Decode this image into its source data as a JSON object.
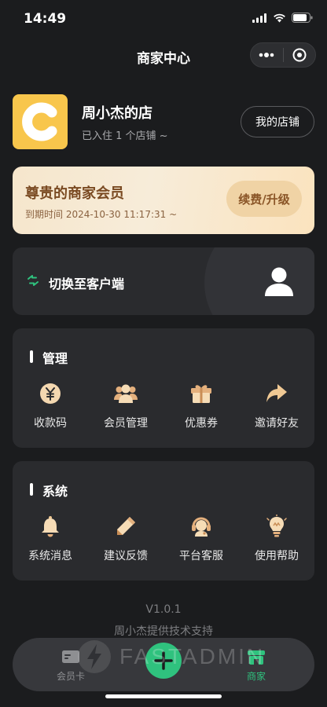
{
  "status": {
    "time": "14:49"
  },
  "nav": {
    "title": "商家中心"
  },
  "shop": {
    "name": "周小杰的店",
    "subtitle": "已入住 1 个店铺 ~",
    "my_shop_label": "我的店铺"
  },
  "vip": {
    "title": "尊贵的商家会员",
    "expire": "到期时间 2024-10-30 11:17:31 ~",
    "renew_label": "续费/升级"
  },
  "switch": {
    "label": "切换至客户端"
  },
  "manage": {
    "title": "管理",
    "items": [
      {
        "label": "收款码",
        "icon": "yen-coin-icon"
      },
      {
        "label": "会员管理",
        "icon": "members-icon"
      },
      {
        "label": "优惠券",
        "icon": "coupon-gift-icon"
      },
      {
        "label": "邀请好友",
        "icon": "share-arrow-icon"
      }
    ]
  },
  "system": {
    "title": "系统",
    "items": [
      {
        "label": "系统消息",
        "icon": "bell-icon"
      },
      {
        "label": "建议反馈",
        "icon": "pencil-icon"
      },
      {
        "label": "平台客服",
        "icon": "headset-icon"
      },
      {
        "label": "使用帮助",
        "icon": "lightbulb-icon"
      }
    ]
  },
  "footer": {
    "version": "V1.0.1",
    "support": "周小杰提供技术支持"
  },
  "tabbar": {
    "left_label": "会员卡",
    "right_label": "商家",
    "watermark": "FASTADMIN",
    "active_color": "#2fc27e"
  },
  "colors": {
    "accent": "#2fc27e",
    "background": "#1b1c1e",
    "card": "#2a2b2e",
    "vip_text": "#7a4a22"
  }
}
